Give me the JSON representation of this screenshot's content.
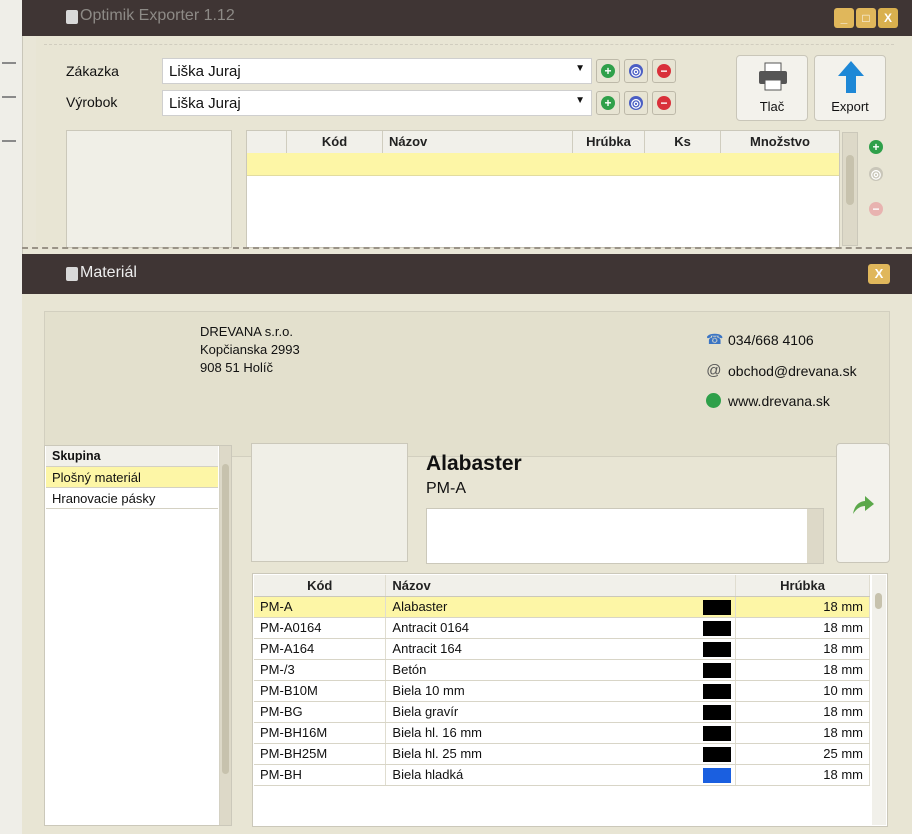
{
  "main_window": {
    "title": "Optimik Exporter 1.12",
    "window_buttons": {
      "minimize": "_",
      "maximize": "□",
      "close": "X"
    },
    "zakazka_label": "Zákazka",
    "zakazka_value": "Liška Juraj",
    "vyrobok_label": "Výrobok",
    "vyrobok_value": "Liška Juraj",
    "print_label": "Tlač",
    "export_label": "Export",
    "grid_headers": [
      "Kód",
      "Názov",
      "Hrúbka",
      "Ks",
      "Množstvo"
    ]
  },
  "dialog": {
    "title": "Materiál",
    "close": "X",
    "company": {
      "name": "DREVANA s.r.o.",
      "street": "Kopčianska 2993",
      "city": "908 51  Holíč",
      "phone": "034/668 4106",
      "email": "obchod@drevana.sk",
      "web": "www.drevana.sk"
    },
    "groups": {
      "header": "Skupina",
      "items": [
        "Plošný materiál",
        "Hranovacie pásky"
      ],
      "selected": "Plošný materiál"
    },
    "selected_material": {
      "name": "Alabaster",
      "code": "PM-A"
    },
    "table": {
      "headers": [
        "Kód",
        "Názov",
        "Hrúbka"
      ],
      "rows": [
        {
          "code": "PM-A",
          "name": "Alabaster",
          "color": "#000000",
          "thickness": "18 mm"
        },
        {
          "code": "PM-A0164",
          "name": "Antracit 0164",
          "color": "#000000",
          "thickness": "18 mm"
        },
        {
          "code": "PM-A164",
          "name": "Antracit 164",
          "color": "#000000",
          "thickness": "18 mm"
        },
        {
          "code": "PM-/3",
          "name": "Betón",
          "color": "#000000",
          "thickness": "18 mm"
        },
        {
          "code": "PM-B10M",
          "name": "Biela 10 mm",
          "color": "#000000",
          "thickness": "10 mm"
        },
        {
          "code": "PM-BG",
          "name": "Biela gravír",
          "color": "#000000",
          "thickness": "18 mm"
        },
        {
          "code": "PM-BH16M",
          "name": "Biela hl. 16 mm",
          "color": "#000000",
          "thickness": "18 mm"
        },
        {
          "code": "PM-BH25M",
          "name": "Biela hl. 25 mm",
          "color": "#000000",
          "thickness": "25 mm"
        },
        {
          "code": "PM-BH",
          "name": "Biela hladká",
          "color": "#1a5fe0",
          "thickness": "18 mm"
        }
      ]
    }
  },
  "colors": {
    "titlebar": "#3f3534",
    "selection": "#fdf6a6",
    "accent_green": "#2fa04a",
    "accent_red": "#d9303a"
  }
}
